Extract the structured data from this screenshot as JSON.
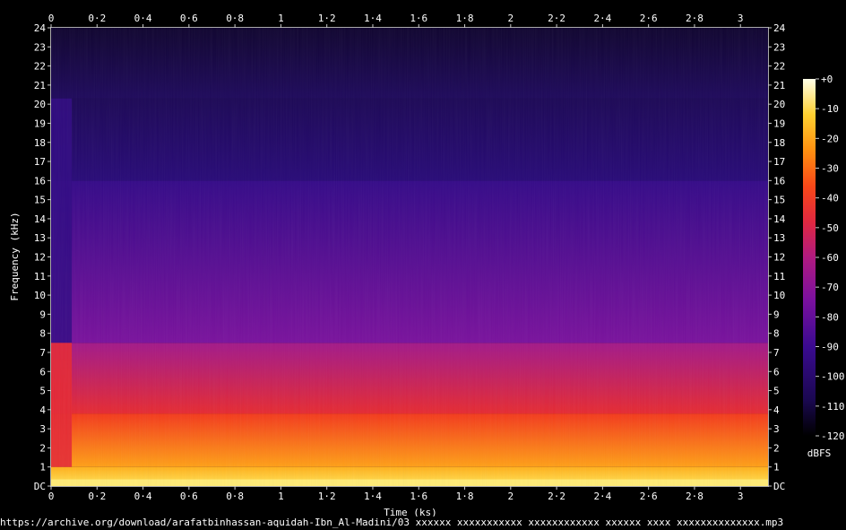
{
  "chart_data": {
    "type": "heatmap",
    "title": "",
    "xlabel": "Time (ks)",
    "ylabel": "Frequency (kHz)",
    "x_ticks": [
      "0",
      "0·2",
      "0·4",
      "0·6",
      "0·8",
      "1",
      "1·2",
      "1·4",
      "1·6",
      "1·8",
      "2",
      "2·2",
      "2·4",
      "2·6",
      "2·8",
      "3"
    ],
    "x_tick_values": [
      0,
      0.2,
      0.4,
      0.6,
      0.8,
      1.0,
      1.2,
      1.4,
      1.6,
      1.8,
      2.0,
      2.2,
      2.4,
      2.6,
      2.8,
      3.0
    ],
    "xlim": [
      0,
      3.12
    ],
    "y_ticks": [
      "DC",
      "1",
      "2",
      "3",
      "4",
      "5",
      "6",
      "7",
      "8",
      "9",
      "10",
      "11",
      "12",
      "13",
      "14",
      "15",
      "16",
      "17",
      "18",
      "19",
      "20",
      "21",
      "22",
      "23",
      "24"
    ],
    "y_tick_values": [
      0,
      1,
      2,
      3,
      4,
      5,
      6,
      7,
      8,
      9,
      10,
      11,
      12,
      13,
      14,
      15,
      16,
      17,
      18,
      19,
      20,
      21,
      22,
      23,
      24
    ],
    "ylim": [
      0,
      24
    ],
    "colorbar": {
      "label": "dBFS",
      "ticks": [
        "+0",
        "-10",
        "-20",
        "-30",
        "-40",
        "-50",
        "-60",
        "-70",
        "-80",
        "-90",
        "-100",
        "-110",
        "-120"
      ],
      "tick_values": [
        0,
        -10,
        -20,
        -30,
        -40,
        -50,
        -60,
        -70,
        -80,
        -90,
        -100,
        -110,
        -120
      ],
      "range": [
        -120,
        0
      ]
    },
    "bands": [
      {
        "from_khz": 0,
        "to_khz": 1,
        "level_dbfs": -15
      },
      {
        "from_khz": 1,
        "to_khz": 3.8,
        "level_dbfs": -30
      },
      {
        "from_khz": 3.8,
        "to_khz": 7.5,
        "level_dbfs": -52
      },
      {
        "from_khz": 7.5,
        "to_khz": 16,
        "level_dbfs": -82
      },
      {
        "from_khz": 16,
        "to_khz": 20.3,
        "level_dbfs": -105
      },
      {
        "from_khz": 20.3,
        "to_khz": 24,
        "level_dbfs": -112
      }
    ],
    "colors": [
      "#000000",
      "#1a0850",
      "#3a0a90",
      "#6a10a0",
      "#a01a90",
      "#d0205a",
      "#f03020",
      "#ff7010",
      "#ffb818",
      "#ffe860",
      "#ffffe8"
    ]
  },
  "footer_text": "https://archive.org/download/arafatbinhassan-aquidah-Ibn_Al-Madini/03 xxxxxx xxxxxxxxxxx xxxxxxxxxxxx xxxxxx xxxx xxxxxxxxxxxxxx.mp3"
}
